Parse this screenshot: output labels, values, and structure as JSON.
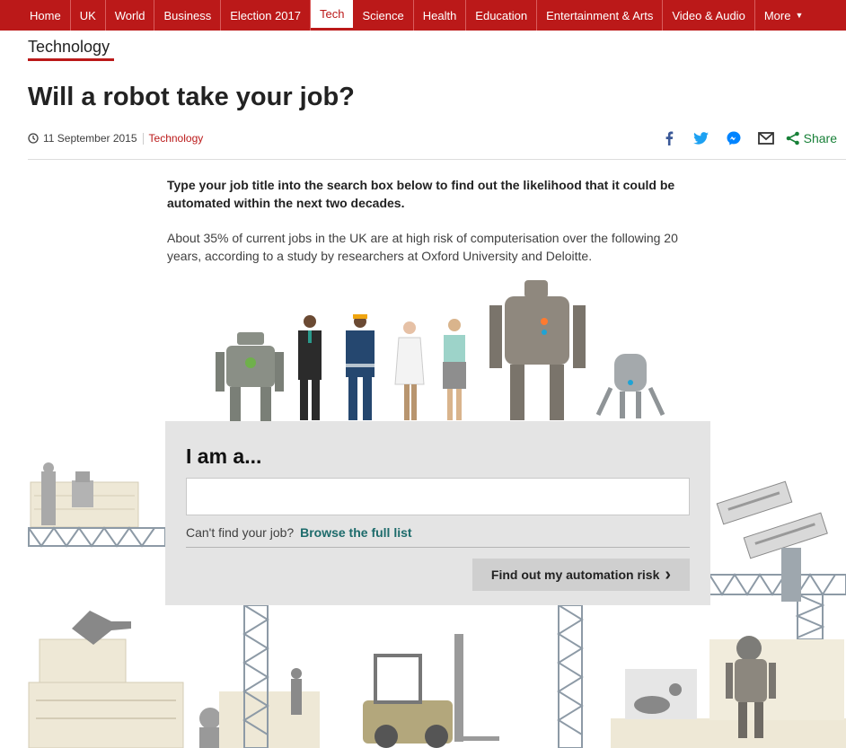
{
  "nav": {
    "items": [
      "Home",
      "UK",
      "World",
      "Business",
      "Election 2017",
      "Tech",
      "Science",
      "Health",
      "Education",
      "Entertainment & Arts",
      "Video & Audio",
      "More"
    ],
    "active": "Tech"
  },
  "section_title": "Technology",
  "headline": "Will a robot take your job?",
  "meta": {
    "date": "11 September 2015",
    "topic": "Technology"
  },
  "share": {
    "label": "Share",
    "icons": [
      "facebook-icon",
      "twitter-icon",
      "messenger-icon",
      "email-icon",
      "share-icon"
    ]
  },
  "intro_bold": "Type your job title into the search box below to find out the likelihood that it could be automated within the next two decades.",
  "intro_text": "About 35% of current jobs in the UK are at high risk of computerisation over the following 20 years, according to a study by researchers at Oxford University and Deloitte.",
  "search_panel": {
    "title": "I am a...",
    "input_value": "",
    "help_text": "Can't find your job?",
    "help_link": "Browse the full list",
    "button_label": "Find out my automation risk"
  },
  "colors": {
    "brand": "#bb1919",
    "link": "#1d6b6b",
    "share": "#188038"
  }
}
